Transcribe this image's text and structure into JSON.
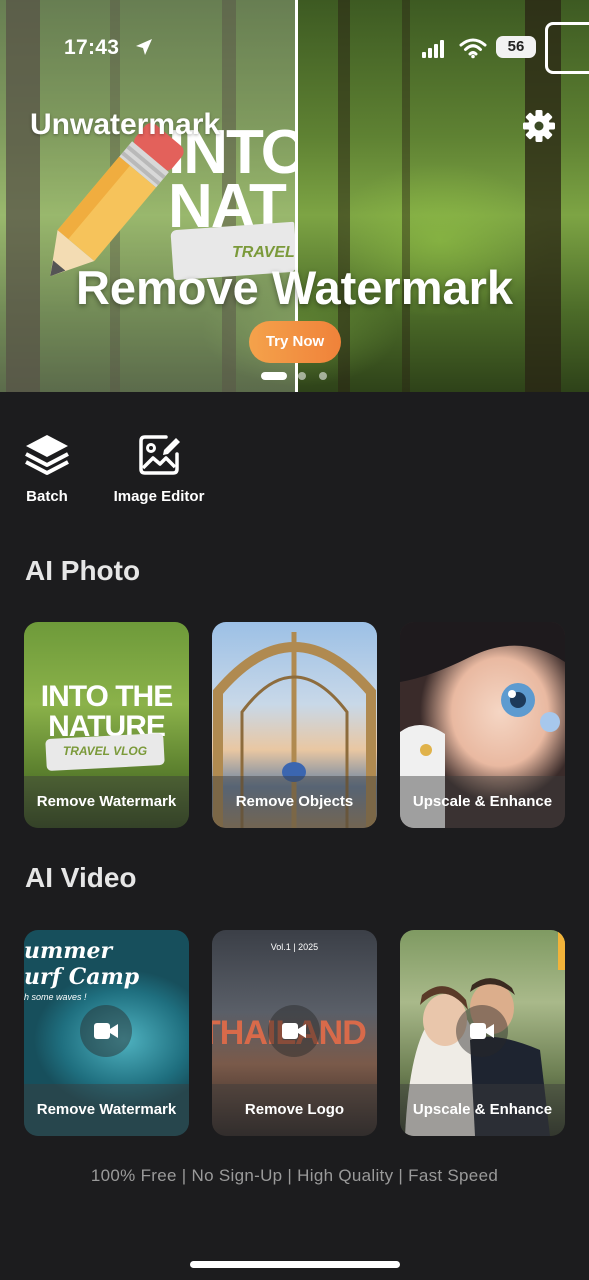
{
  "status_bar": {
    "time": "17:43",
    "battery": "56"
  },
  "app": {
    "title": "Unwatermark"
  },
  "hero": {
    "artwork_text_top": "INTO",
    "artwork_text_bottom": "NAT",
    "artwork_tag": "TRAVEL",
    "headline": "Remove Watermark",
    "cta_label": "Try Now",
    "active_slide": 1,
    "slide_count": 3
  },
  "tools": [
    {
      "label": "Batch",
      "icon": "stack-layers-icon"
    },
    {
      "label": "Image Editor",
      "icon": "image-edit-icon"
    }
  ],
  "ai_photo": {
    "title": "AI Photo",
    "cards": [
      {
        "label": "Remove Watermark",
        "art_text": "INTO THE",
        "art_text2": "NATURE",
        "art_tag": "TRAVEL VLOG"
      },
      {
        "label": "Remove Objects"
      },
      {
        "label": "Upscale & Enhance"
      }
    ]
  },
  "ai_video": {
    "title": "AI Video",
    "cards": [
      {
        "label": "Remove Watermark",
        "art_text": "ummer",
        "art_text2": "urf Camp",
        "art_sub": "h some waves !"
      },
      {
        "label": "Remove Logo",
        "art_text": "THAILAND",
        "art_tag": "Vol.1 | 2025"
      },
      {
        "label": "Upscale & Enhance"
      }
    ]
  },
  "footer": {
    "note": "100% Free | No Sign-Up | High Quality | Fast Speed"
  },
  "colors": {
    "background": "#1c1c1e",
    "cta_start": "#f4a24b",
    "cta_end": "#f0823a",
    "muted_text": "#9a9a9a"
  }
}
